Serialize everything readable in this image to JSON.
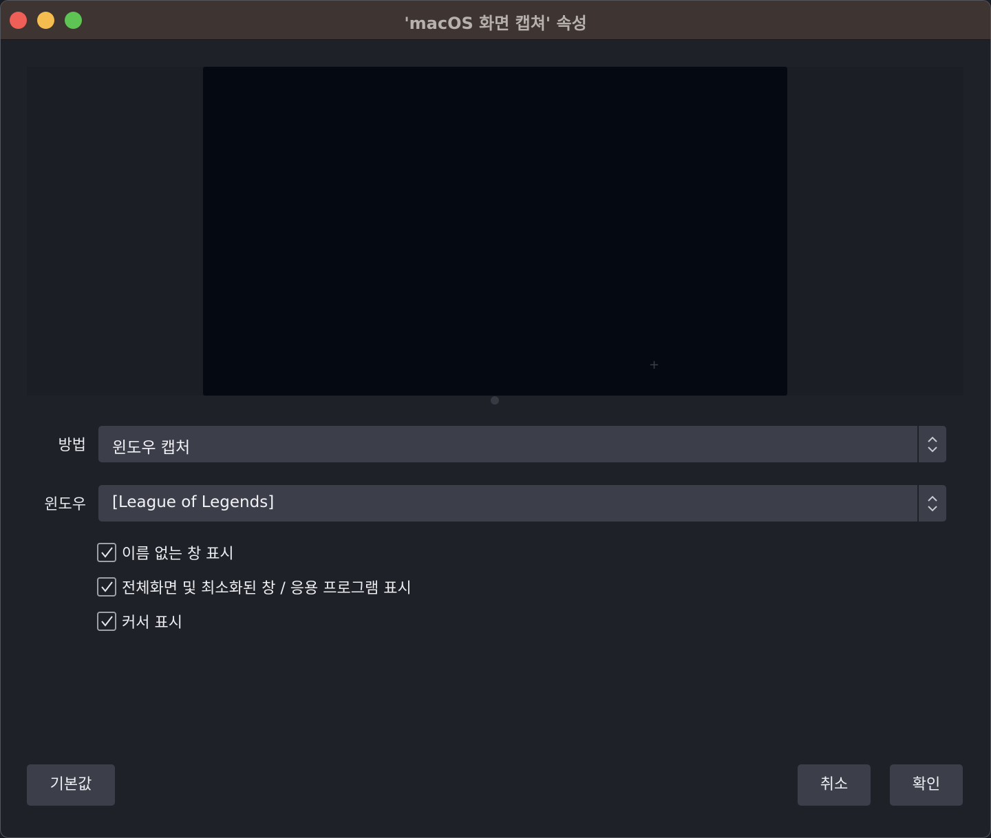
{
  "window": {
    "title": "'macOS 화면 캡쳐' 속성"
  },
  "form": {
    "method_label": "방법",
    "method_value": "윈도우 캡처",
    "window_label": "윈도우",
    "window_value": "[League of Legends]"
  },
  "checkboxes": [
    {
      "label": "이름 없는 창 표시",
      "checked": true
    },
    {
      "label": "전체화면 및 최소화된 창 / 응용 프로그램 표시",
      "checked": true
    },
    {
      "label": "커서 표시",
      "checked": true
    }
  ],
  "buttons": {
    "defaults": "기본값",
    "cancel": "취소",
    "ok": "확인"
  },
  "colors": {
    "titlebar": "#3e3533",
    "background": "#1f2129",
    "control": "#3c3e4a",
    "close": "#ee5f57",
    "minimize": "#f5bd4f",
    "maximize": "#5ec454"
  }
}
